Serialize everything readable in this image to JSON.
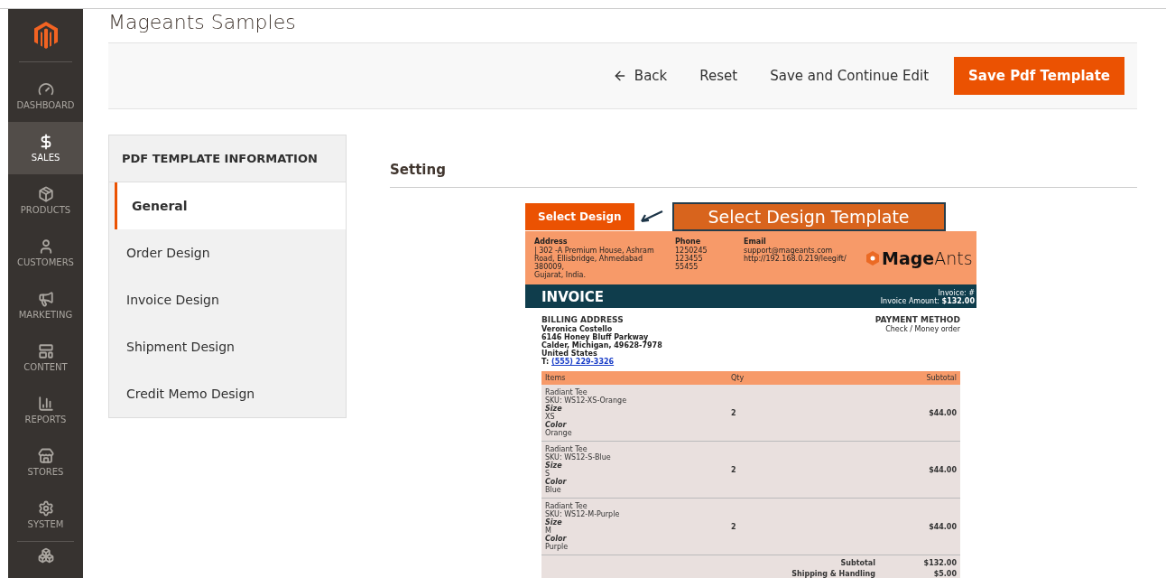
{
  "sidebar": {
    "items": [
      {
        "kind": "dashboard",
        "label": "DASHBOARD",
        "selected": false
      },
      {
        "kind": "sales",
        "label": "SALES",
        "selected": true
      },
      {
        "kind": "products",
        "label": "PRODUCTS",
        "selected": false
      },
      {
        "kind": "customers",
        "label": "CUSTOMERS",
        "selected": false
      },
      {
        "kind": "marketing",
        "label": "MARKETING",
        "selected": false
      },
      {
        "kind": "content",
        "label": "CONTENT",
        "selected": false
      },
      {
        "kind": "reports",
        "label": "REPORTS",
        "selected": false
      },
      {
        "kind": "stores",
        "label": "STORES",
        "selected": false
      },
      {
        "kind": "system",
        "label": "SYSTEM",
        "selected": false
      },
      {
        "kind": "extensions",
        "selected": false
      }
    ]
  },
  "page_title": "Mageants Samples",
  "toolbar": {
    "back": "Back",
    "reset": "Reset",
    "save_continue": "Save and Continue Edit",
    "save": "Save Pdf Template"
  },
  "tabs_panel": {
    "title": "PDF TEMPLATE INFORMATION",
    "tabs": [
      {
        "label": "General",
        "selected": true
      },
      {
        "label": "Order Design",
        "selected": false
      },
      {
        "label": "Invoice Design",
        "selected": false
      },
      {
        "label": "Shipment Design",
        "selected": false
      },
      {
        "label": "Credit Memo Design",
        "selected": false
      }
    ]
  },
  "section_title": "Setting",
  "preview": {
    "select_button": "Select Design",
    "callout": "Select Design Template",
    "header": [
      {
        "label": "Address",
        "lines": [
          "| 302 -A Premium House, Ashram",
          "Road, Ellisbridge, Ahmedabad 380009,",
          "Gujarat, India."
        ]
      },
      {
        "label": "Phone",
        "lines": [
          "1250245",
          "123455",
          "55455"
        ]
      },
      {
        "label": "Email",
        "lines": [
          "support@mageants.com",
          "http://192.168.0.219/leegift/"
        ]
      }
    ],
    "logo": {
      "bold": "Mage",
      "light": "Ants"
    },
    "title": "INVOICE",
    "invoice_no": "Invoice: #",
    "amount_label": "Invoice Amount:",
    "amount": "$132.00",
    "billing": {
      "title": "BILLING ADDRESS",
      "lines": [
        "Veronica Costello",
        "6146 Honey Bluff Parkway",
        "Calder, Michigan, 49628-7978",
        "United States"
      ],
      "phone_label": "T:",
      "phone": "(555) 229-3326"
    },
    "payment": {
      "title": "PAYMENT METHOD",
      "value": "Check / Money order"
    },
    "columns": [
      "Items",
      "Qty",
      "Subtotal"
    ],
    "rows": [
      {
        "name": "Radiant Tee",
        "sku": "SKU: WS12-XS-Orange",
        "size_label": "Size",
        "size": "XS",
        "color_label": "Color",
        "color_value": "Orange",
        "qty": "2",
        "subtotal": "$44.00"
      },
      {
        "name": "Radiant Tee",
        "sku": "SKU: WS12-S-Blue",
        "size_label": "Size",
        "size": "S",
        "color_label": "Color",
        "color_value": "Blue",
        "qty": "2",
        "subtotal": "$44.00"
      },
      {
        "name": "Radiant Tee",
        "sku": "SKU: WS12-M-Purple",
        "size_label": "Size",
        "size": "M",
        "color_label": "Color",
        "color_value": "Purple",
        "qty": "2",
        "subtotal": "$44.00"
      }
    ],
    "totals": [
      {
        "label": "Subtotal",
        "value": "$132.00"
      },
      {
        "label": "Shipping & Handling",
        "value": "$5.00"
      }
    ]
  }
}
